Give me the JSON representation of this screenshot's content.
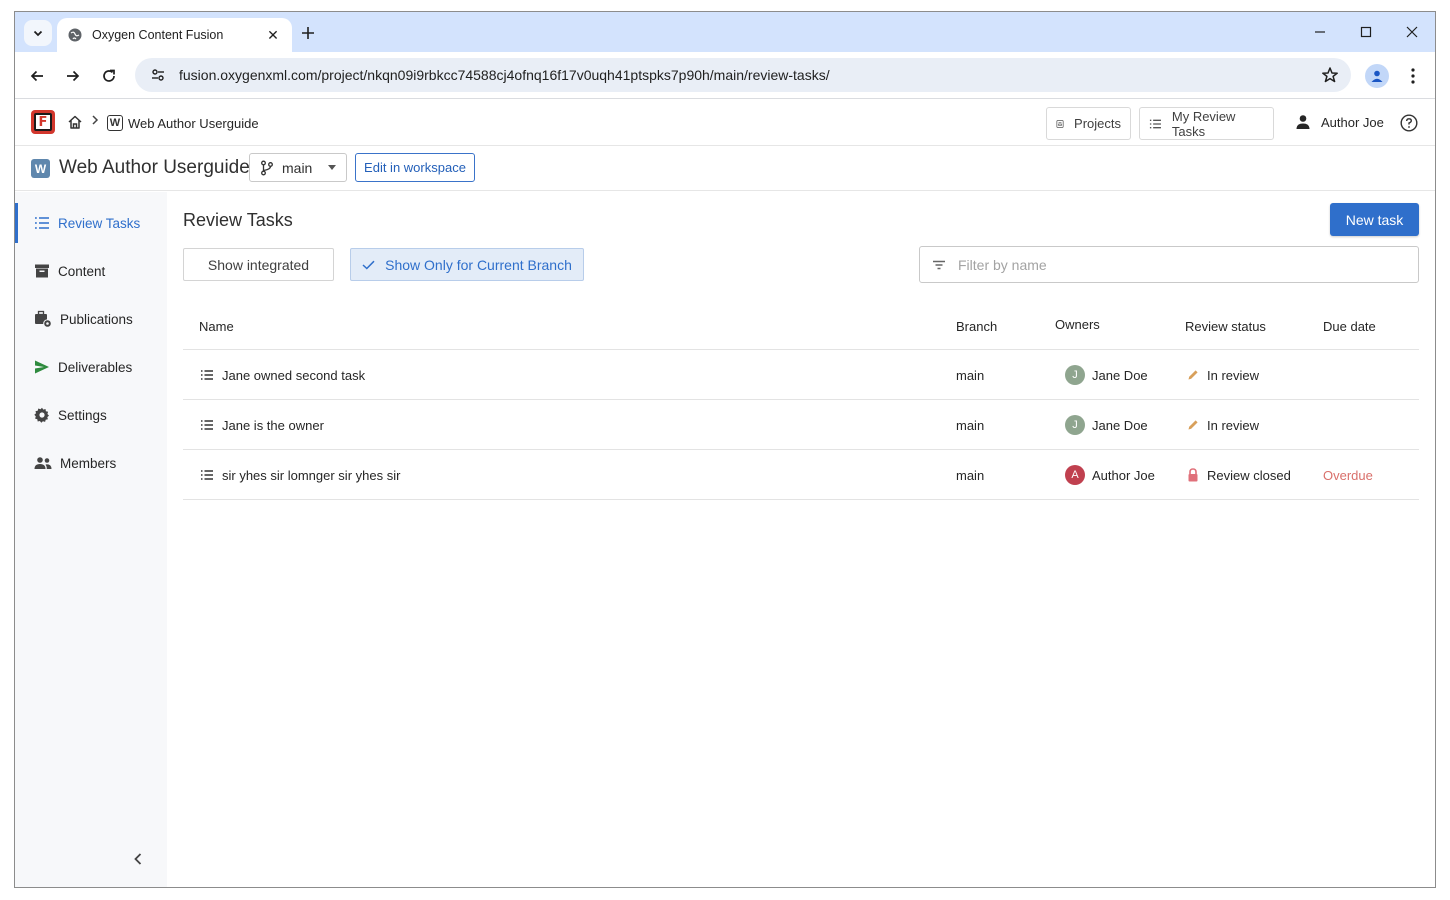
{
  "browser": {
    "tab_title": "Oxygen Content Fusion",
    "url": "fusion.oxygenxml.com/project/nkqn09i9rbkcc74588cj4ofnq16f17v0uqh41ptspks7p90h/main/review-tasks/"
  },
  "header": {
    "logo_letter": "F",
    "breadcrumb_project_letter": "W",
    "breadcrumb_project": "Web Author Userguide",
    "projects_label": "Projects",
    "my_review_tasks_label": "My Review Tasks",
    "user_name": "Author Joe"
  },
  "project": {
    "letter": "W",
    "title": "Web Author Userguide",
    "branch": "main",
    "edit_label": "Edit in workspace"
  },
  "sidebar": {
    "items": [
      {
        "label": "Review Tasks",
        "icon": "list-icon",
        "active": true
      },
      {
        "label": "Content",
        "icon": "archive-icon"
      },
      {
        "label": "Publications",
        "icon": "publications-icon"
      },
      {
        "label": "Deliverables",
        "icon": "send-icon"
      },
      {
        "label": "Settings",
        "icon": "gear-icon"
      },
      {
        "label": "Members",
        "icon": "people-icon"
      }
    ]
  },
  "main": {
    "title": "Review Tasks",
    "new_task_label": "New task",
    "show_integrated_label": "Show integrated",
    "show_current_branch_label": "Show Only for Current Branch",
    "filter_placeholder": "Filter by name",
    "columns": [
      "Name",
      "Branch",
      "Owners",
      "Review status",
      "Due date"
    ],
    "rows": [
      {
        "name": "Jane owned second task",
        "branch": "main",
        "owner": "Jane Doe",
        "owner_initial": "J",
        "owner_color": "#8fa58f",
        "status": "In review",
        "status_icon": "pencil-icon",
        "due": ""
      },
      {
        "name": "Jane is the owner",
        "branch": "main",
        "owner": "Jane Doe",
        "owner_initial": "J",
        "owner_color": "#8fa58f",
        "status": "In review",
        "status_icon": "pencil-icon",
        "due": ""
      },
      {
        "name": "sir yhes sir lomnger sir yhes sir",
        "branch": "main",
        "owner": "Author Joe",
        "owner_initial": "A",
        "owner_color": "#c0404f",
        "status": "Review closed",
        "status_icon": "lock-icon",
        "due": "Overdue"
      }
    ]
  },
  "colors": {
    "accent": "#2f6fcb",
    "brand": "#d2372d",
    "overdue": "#d9706b"
  }
}
